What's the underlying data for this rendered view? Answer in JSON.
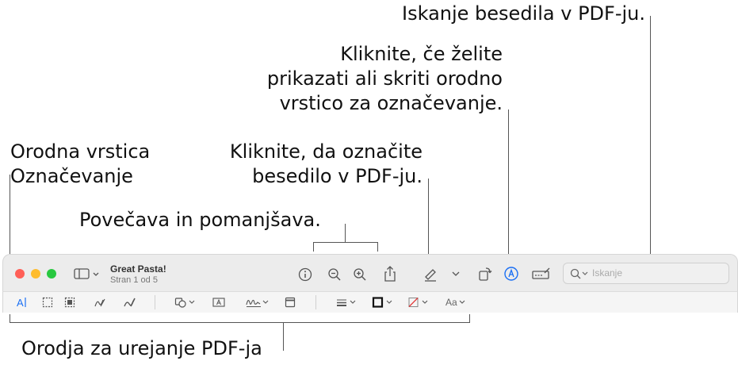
{
  "callouts": {
    "search": "Iskanje besedila v PDF-ju.",
    "markup_toggle_1": "Kliknite, če želite",
    "markup_toggle_2": "prikazati ali skriti orodno",
    "markup_toggle_3": "vrstico za označevanje.",
    "markup_toolbar_1": "Orodna vrstica",
    "markup_toolbar_2": "Označevanje",
    "highlight_1": "Kliknite, da označite",
    "highlight_2": "besedilo v PDF-ju.",
    "zoom": "Povečava in pomanjšava.",
    "edit_tools": "Orodja za urejanje PDF-ja"
  },
  "window": {
    "title": "Great Pasta!",
    "subtitle": "Stran 1 od 5",
    "search_placeholder": "Iskanje",
    "font_button": "Aa",
    "text_select_button": "A"
  },
  "colors": {
    "close": "#ff5f57",
    "minimize": "#febc2e",
    "zoom": "#28c840",
    "accent": "#1a6ff4"
  }
}
